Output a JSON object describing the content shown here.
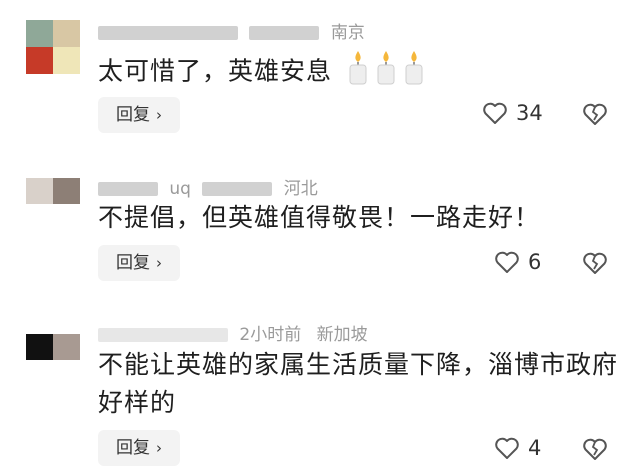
{
  "comments": [
    {
      "meta": {
        "location": "南京"
      },
      "text": "太可惜了，英雄安息",
      "emoji": [
        "candle-icon",
        "candle-icon",
        "candle-icon"
      ],
      "reply_label": "回复",
      "like_count": "34"
    },
    {
      "meta": {
        "handle_fragment": "uq",
        "location": "河北"
      },
      "text": "不提倡，但英雄值得敬畏！一路走好！",
      "reply_label": "回复",
      "like_count": "6"
    },
    {
      "meta": {
        "time": "2小时前",
        "location": "新加坡"
      },
      "text": "不能让英雄的家属生活质量下降，淄博市政府好样的",
      "reply_label": "回复",
      "like_count": "4"
    }
  ],
  "colors": {
    "like_icon": "#555555",
    "reply_bg": "#f3f3f3",
    "meta_text": "#9a9a9a"
  }
}
